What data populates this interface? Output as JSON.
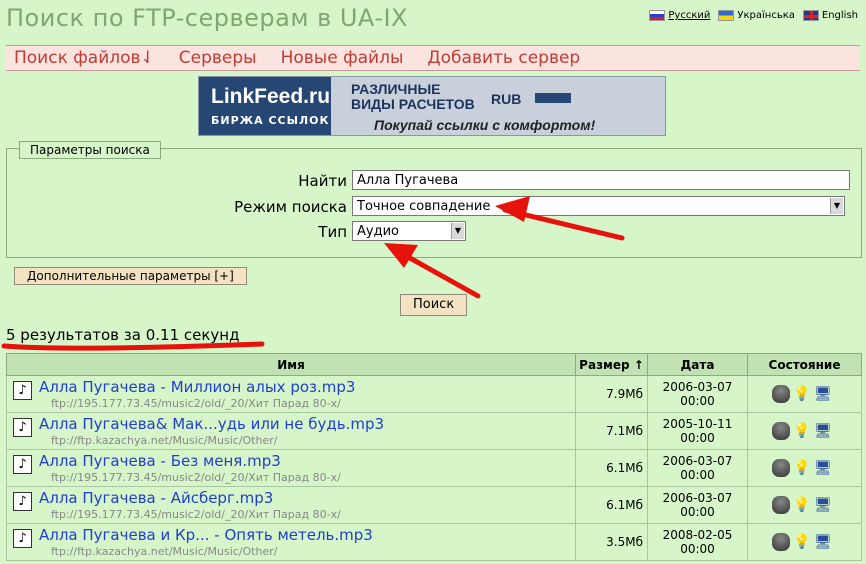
{
  "header": {
    "title": "Поиск по FTP-серверам в UA-IX",
    "languages": [
      {
        "label": "Русский",
        "flag": "flag-ru-icon"
      },
      {
        "label": "Українська",
        "flag": "flag-ua-icon"
      },
      {
        "label": "English",
        "flag": "flag-en-icon"
      }
    ]
  },
  "menu": [
    "Поиск файлов⇃",
    "Серверы",
    "Новые файлы",
    "Добавить сервер"
  ],
  "banner": {
    "logo": "LinkFeed.ru",
    "subtitle": "БИРЖА ССЫЛОК",
    "line1": "РАЗЛИЧНЫЕ",
    "line2": "ВИДЫ РАСЧЕТОВ",
    "currency": "RUB",
    "slogan": "Покупай ссылки с комфортом!"
  },
  "search": {
    "legend": "Параметры поиска",
    "find_label": "Найти",
    "find_value": "Алла Пугачева",
    "mode_label": "Режим поиска",
    "mode_value": "Точное совпадение",
    "type_label": "Тип",
    "type_value": "Аудио",
    "advanced_label": "Дополнительные параметры [+]",
    "submit_label": "Поиск"
  },
  "results_count": "5 результатов за 0.11 секунд",
  "table": {
    "headers": {
      "name": "Имя",
      "size": "Размер ↑",
      "date": "Дата",
      "status": "Состояние"
    },
    "rows": [
      {
        "name": "Алла Пугачева - Миллион алых роз.mp3",
        "path": "ftp://195.177.73.45/music2/old/_20/Хит Парад 80-х/",
        "size": "7.9Мб",
        "date": "2006-03-07 00:00"
      },
      {
        "name": "Алла Пугачева& Мак...удь или не будь.mp3",
        "path": "ftp://ftp.kazachya.net/Music/Music/Other/",
        "size": "7.1Мб",
        "date": "2005-10-11 00:00"
      },
      {
        "name": "Алла Пугачева - Без меня.mp3",
        "path": "ftp://195.177.73.45/music2/old/_20/Хит Парад 80-х/",
        "size": "6.1Мб",
        "date": "2006-03-07 00:00"
      },
      {
        "name": "Алла Пугачева - Айсберг.mp3",
        "path": "ftp://195.177.73.45/music2/old/_20/Хит Парад 80-х/",
        "size": "6.1Мб",
        "date": "2006-03-07 00:00"
      },
      {
        "name": "Алла Пугачева и Кр... - Опять метель.mp3",
        "path": "ftp://ftp.kazachya.net/Music/Music/Other/",
        "size": "3.5Мб",
        "date": "2008-02-05 00:00"
      }
    ]
  },
  "colors": {
    "annotation": "#e8120c",
    "link": "#1f3fd0",
    "menu": "#c23b32",
    "background": "#d6f5c9"
  }
}
